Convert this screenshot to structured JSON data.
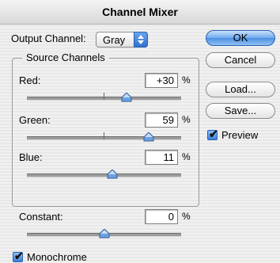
{
  "window": {
    "title": "Channel Mixer"
  },
  "output_channel": {
    "label": "Output Channel:",
    "value": "Gray"
  },
  "source_channels": {
    "title": "Source Channels",
    "red": {
      "label": "Red:",
      "value": "+30",
      "unit": "%",
      "slider_percent": 30
    },
    "green": {
      "label": "Green:",
      "value": "59",
      "unit": "%",
      "slider_percent": 59
    },
    "blue": {
      "label": "Blue:",
      "value": "11",
      "unit": "%",
      "slider_percent": 11
    }
  },
  "constant": {
    "label": "Constant:",
    "value": "0",
    "unit": "%",
    "slider_percent": 0
  },
  "buttons": {
    "ok": "OK",
    "cancel": "Cancel",
    "load": "Load...",
    "save": "Save..."
  },
  "preview": {
    "label": "Preview",
    "checked": true
  },
  "monochrome": {
    "label": "Monochrome",
    "checked": true
  },
  "colors": {
    "accent": "#4d8fe0",
    "thumb": "#6aa0e0"
  }
}
